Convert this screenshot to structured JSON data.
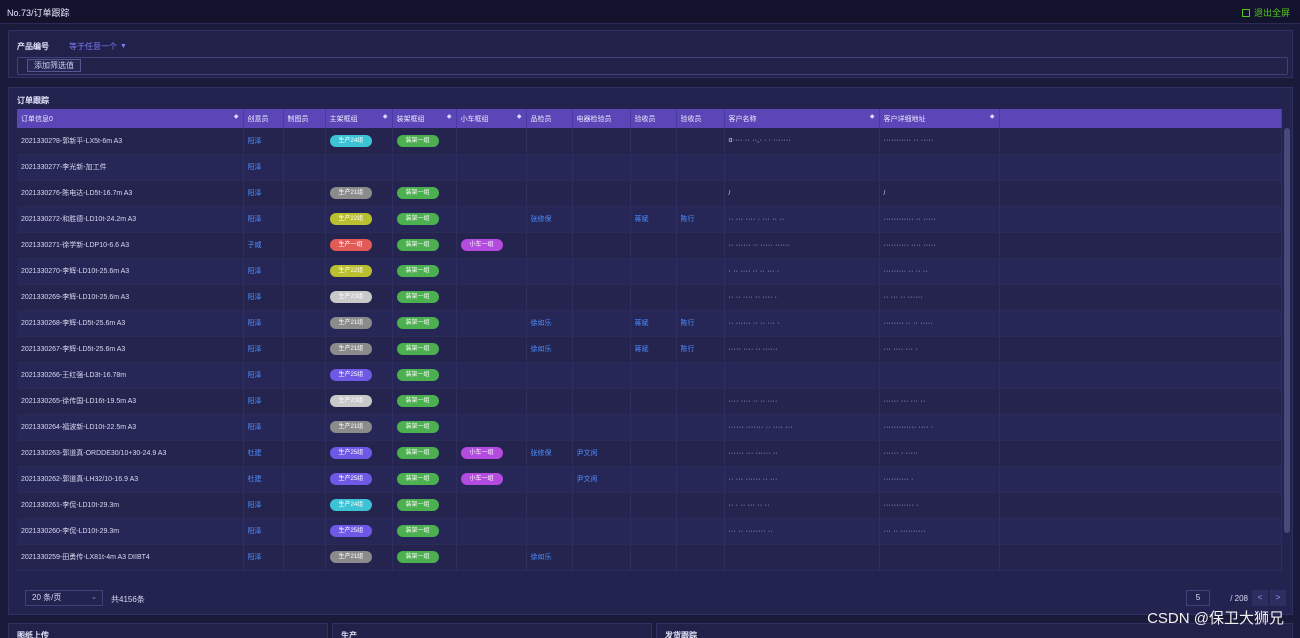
{
  "window": {
    "title": "No.73/订单跟踪",
    "exit_label": "退出全屏"
  },
  "filter": {
    "field_label": "产品编号",
    "selector_label": "等于任意一个",
    "add_filter_label": "添加筛选值"
  },
  "panel": {
    "title": "订单跟踪"
  },
  "table": {
    "headers": [
      "订单信息0",
      "创意员",
      "制图员",
      "主架框组",
      "装架框组",
      "小车框组",
      "品检员",
      "电器检验员",
      "验收员",
      "验收员",
      "客户名称",
      "客户详细地址"
    ],
    "rows": [
      {
        "order": "20213302?8-郭新平-LX5t-6m A3",
        "c1": "阳泽",
        "tag1": "生产24组",
        "tag1c": "#3dc3d4",
        "tag2": "装架一组",
        "tag3": "",
        "inspector": "",
        "electric": "",
        "acc1": "",
        "acc2": "",
        "customer": "ɑ···· ·· ··,· · · ·······",
        "address": "··········· ·· ·····"
      },
      {
        "order": "2021330277-李光新-加工件",
        "c1": "阳泽",
        "tag1": "",
        "tag1c": "",
        "tag2": "",
        "tag3": "",
        "inspector": "",
        "electric": "",
        "acc1": "",
        "acc2": "",
        "customer": "",
        "address": ""
      },
      {
        "order": "2021330276-陈电达-LD5t-16.7m A3",
        "c1": "阳泽",
        "tag1": "生产21组",
        "tag1c": "#8b8b8b",
        "tag2": "装架一组",
        "tag3": "",
        "inspector": "",
        "electric": "",
        "acc1": "",
        "acc2": "",
        "customer": "/",
        "address": "/"
      },
      {
        "order": "2021330272-和胜德-LD10t-24.2m A3",
        "c1": "阳泽",
        "tag1": "生产22组",
        "tag1c": "#b9bf2f",
        "tag2": "装架一组",
        "tag3": "",
        "inspector": "张修保",
        "electric": "",
        "acc1": "蒋斌",
        "acc2": "陈行",
        "customer": "·· ··· ···· · ··· ·· ··",
        "address": "············ ·· ·····"
      },
      {
        "order": "2021330271-徐学新-LDP10-6.6 A3",
        "c1": "子威",
        "tag1": "生产一组",
        "tag1c": "#e25b57",
        "tag2": "装架一组",
        "tag3": "小车一组",
        "inspector": "",
        "electric": "",
        "acc1": "",
        "acc2": "",
        "customer": "·· ······ ·· ····· ······",
        "address": "·········· ···· ·····"
      },
      {
        "order": "2021330270-李辉-LD10t-25.6m A3",
        "c1": "阳泽",
        "tag1": "生产22组",
        "tag1c": "#b9bf2f",
        "tag2": "装架一组",
        "tag3": "",
        "inspector": "",
        "electric": "",
        "acc1": "",
        "acc2": "",
        "customer": "· ·· ···· ·· ·· ··· ·",
        "address": "········· ·· ·· ··"
      },
      {
        "order": "2021330269-李辉-LD10t-25.6m A3",
        "c1": "阳泽",
        "tag1": "生产23组",
        "tag1c": "#c9c9c9",
        "tag2": "装架一组",
        "tag3": "",
        "inspector": "",
        "electric": "",
        "acc1": "",
        "acc2": "",
        "customer": "·· ·· ···· ·· ···· ·",
        "address": "·· ··· ·· ······"
      },
      {
        "order": "2021330268-李辉-LD5t-25.6m A3",
        "c1": "阳泽",
        "tag1": "生产21组",
        "tag1c": "#8b8b8b",
        "tag2": "装架一组",
        "tag3": "",
        "inspector": "徐如乐",
        "electric": "",
        "acc1": "蒋斌",
        "acc2": "陈行",
        "customer": "·· ······ ·· ·· ··· ·",
        "address": "········ ·· ·· ·····"
      },
      {
        "order": "2021330267-李辉-LD5t-25.6m A3",
        "c1": "阳泽",
        "tag1": "生产21组",
        "tag1c": "#8b8b8b",
        "tag2": "装架一组",
        "tag3": "",
        "inspector": "徐如乐",
        "electric": "",
        "acc1": "蒋斌",
        "acc2": "陈行",
        "customer": "····· ···· ·· ······",
        "address": "··· ···· ··· ·"
      },
      {
        "order": "2021330266-王红强-LD3t-16.78m",
        "c1": "阳泽",
        "tag1": "生产25组",
        "tag1c": "#6e59e6",
        "tag2": "装架一组",
        "tag3": "",
        "inspector": "",
        "electric": "",
        "acc1": "",
        "acc2": "",
        "customer": "",
        "address": ""
      },
      {
        "order": "2021330265-徐传国-LD16t-19.5m A3",
        "c1": "阳泽",
        "tag1": "生产23组",
        "tag1c": "#c9c9c9",
        "tag2": "装架一组",
        "tag3": "",
        "inspector": "",
        "electric": "",
        "acc1": "",
        "acc2": "",
        "customer": "···· ···· ·· ·· ····",
        "address": "······ ··· ··· ··"
      },
      {
        "order": "2021330264-福波新-LD10t-22.5m A3",
        "c1": "阳泽",
        "tag1": "生产21组",
        "tag1c": "#8b8b8b",
        "tag2": "装架一组",
        "tag3": "",
        "inspector": "",
        "electric": "",
        "acc1": "",
        "acc2": "",
        "customer": "······ ······· ·· ···· ···",
        "address": "············· ···· ·"
      },
      {
        "order": "2021330263-郭道真-ORDDE30/10+30-24.9 A3",
        "c1": "杜建",
        "tag1": "生产25组",
        "tag1c": "#6e59e6",
        "tag2": "装架一组",
        "tag3": "小车一组",
        "inspector": "张修保",
        "electric": "尹文闲",
        "acc1": "",
        "acc2": "",
        "customer": "······ ··· ······ ··",
        "address": "······ · ·····"
      },
      {
        "order": "2021330262-郭道真-LH32/10-16.9 A3",
        "c1": "杜建",
        "tag1": "生产25组",
        "tag1c": "#6e59e6",
        "tag2": "装架一组",
        "tag3": "小车一组",
        "inspector": "",
        "electric": "尹文闲",
        "acc1": "",
        "acc2": "",
        "customer": "·· ··· ······ ·· ···",
        "address": "·········· ·"
      },
      {
        "order": "2021330261-李侃-LD10t-29.3m",
        "c1": "阳泽",
        "tag1": "生产24组",
        "tag1c": "#3dc3d4",
        "tag2": "装架一组",
        "tag3": "",
        "inspector": "",
        "electric": "",
        "acc1": "",
        "acc2": "",
        "customer": "·· · ·· ··· ·· ··",
        "address": "············ ·"
      },
      {
        "order": "2021330260-李侃-LD10t-29.3m",
        "c1": "阳泽",
        "tag1": "生产25组",
        "tag1c": "#6e59e6",
        "tag2": "装架一组",
        "tag3": "",
        "inspector": "",
        "electric": "",
        "acc1": "",
        "acc2": "",
        "customer": "··· ·· ········ ··",
        "address": "··· ·· ··········"
      },
      {
        "order": "2021330259-田勇传-LX81t-4m A3 DIIBT4",
        "c1": "阳泽",
        "tag1": "生产21组",
        "tag1c": "#8b8b8b",
        "tag2": "装架一组",
        "tag3": "",
        "inspector": "徐如乐",
        "electric": "",
        "acc1": "",
        "acc2": "",
        "customer": "",
        "address": ""
      }
    ]
  },
  "pager": {
    "size_label": "20 条/页",
    "total_label": "共4156条",
    "current_page": "5",
    "page_total": "/ 208",
    "prev": "<",
    "next": ">"
  },
  "bottom_tabs": [
    "图纸上传",
    "生产",
    "发货跟踪"
  ],
  "watermark": "CSDN @保卫大狮兄",
  "colors": {
    "primary": "#5b46b7",
    "green": "#52c41a",
    "link": "#4f8fff"
  }
}
